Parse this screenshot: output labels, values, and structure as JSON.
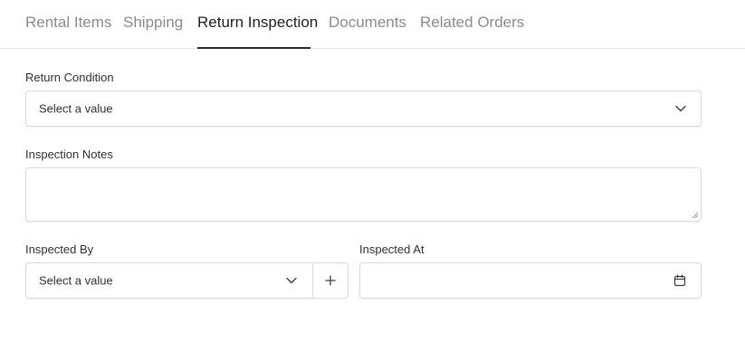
{
  "tabs": [
    {
      "label": "Rental Items",
      "active": false
    },
    {
      "label": "Shipping",
      "active": false
    },
    {
      "label": "Return Inspection",
      "active": true
    },
    {
      "label": "Documents",
      "active": false
    },
    {
      "label": "Related Orders",
      "active": false
    }
  ],
  "form": {
    "return_condition": {
      "label": "Return Condition",
      "value": "Select a value"
    },
    "inspection_notes": {
      "label": "Inspection Notes",
      "value": ""
    },
    "inspected_by": {
      "label": "Inspected By",
      "value": "Select a value",
      "add_icon": "plus-icon"
    },
    "inspected_at": {
      "label": "Inspected At",
      "value": "",
      "icon": "calendar-icon"
    }
  },
  "colors": {
    "active_tab_text": "#1f1f1f",
    "inactive_tab_text": "#8a8a8a",
    "active_tab_underline": "#2b2b2b",
    "field_border": "#d9d9d9"
  }
}
